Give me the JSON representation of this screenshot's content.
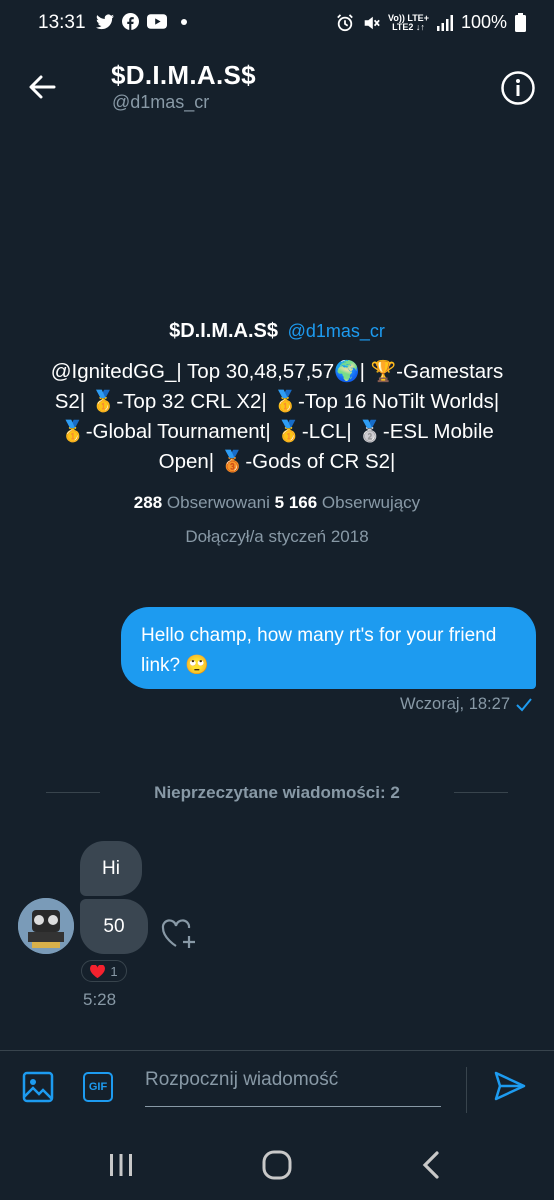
{
  "status_bar": {
    "time": "13:31",
    "battery": "100%",
    "network_top": "Vo)) LTE+",
    "network_bottom": "LTE2 ↓↑",
    "left_icons": [
      "twitter-icon",
      "facebook-icon",
      "youtube-icon",
      "dot-icon"
    ],
    "right_icons": [
      "alarm-icon",
      "mute-icon",
      "signal-icon",
      "battery-icon"
    ]
  },
  "header": {
    "title": "$D.I.M.A.S$",
    "handle": "@d1mas_cr"
  },
  "profile": {
    "name": "$D.I.M.A.S$",
    "handle": "@d1mas_cr",
    "bio_lines": [
      "@IgnitedGG_| Top 30,48,57,57🌍| 🏆-Gamestars",
      "S2| 🥇-Top 32 CRL X2| 🥇-Top 16 NoTilt Worlds|",
      "🥇-Global Tournament| 🥇-LCL| 🥈-ESL Mobile",
      "Open| 🥉-Gods of CR S2|"
    ],
    "following_count": "288",
    "following_label": "Obserwowani",
    "followers_count": "5 166",
    "followers_label": "Obserwujący",
    "joined": "Dołączył/a styczeń 2018"
  },
  "messages": {
    "outgoing_text": "Hello champ, how many rt's for your friend link? 🙄",
    "outgoing_time": "Wczoraj, 18:27",
    "unread_divider": "Nieprzeczytane wiadomości: 2",
    "incoming_1": "Hi",
    "incoming_2": "50",
    "reaction_count": "1",
    "incoming_time": "5:28"
  },
  "composer": {
    "gif_label": "GIF",
    "placeholder": "Rozpocznij wiadomość"
  },
  "colors": {
    "background": "#15202b",
    "accent": "#1d9bf0",
    "muted": "#8899a6",
    "incoming_bubble": "#3a4651"
  }
}
